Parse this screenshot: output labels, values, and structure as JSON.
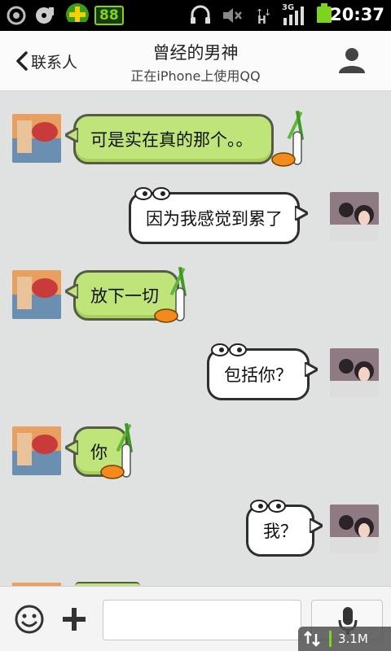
{
  "status_bar": {
    "time": "20:37",
    "app_badge": "88",
    "network_label": "3G",
    "colors": {
      "battery": "#7ed321",
      "badge": "#7ed321"
    }
  },
  "header": {
    "back_label": "联系人",
    "title": "曾经的男神",
    "subtitle": "正在iPhone上使用QQ",
    "icons": {
      "back": "chevron-left-icon",
      "profile": "user-profile-icon"
    }
  },
  "messages": [
    {
      "side": "left",
      "text": "可是实在真的那个。。"
    },
    {
      "side": "right",
      "text": "因为我感觉到累了"
    },
    {
      "side": "left",
      "text": "放下一切"
    },
    {
      "side": "right",
      "text": "包括你？"
    },
    {
      "side": "left",
      "text": "你"
    },
    {
      "side": "right",
      "text": "我？"
    }
  ],
  "input_bar": {
    "message_value": "",
    "icons": {
      "emoji": "smiley-icon",
      "plus": "plus-icon",
      "voice": "microphone-icon"
    }
  },
  "net_overlay": {
    "speed": "3.1M"
  },
  "colors": {
    "chat_bg": "#dfe2e0",
    "bubble_left": "#bfe57a",
    "bubble_right": "#ffffff",
    "header_bg": "#fbfbfb"
  }
}
